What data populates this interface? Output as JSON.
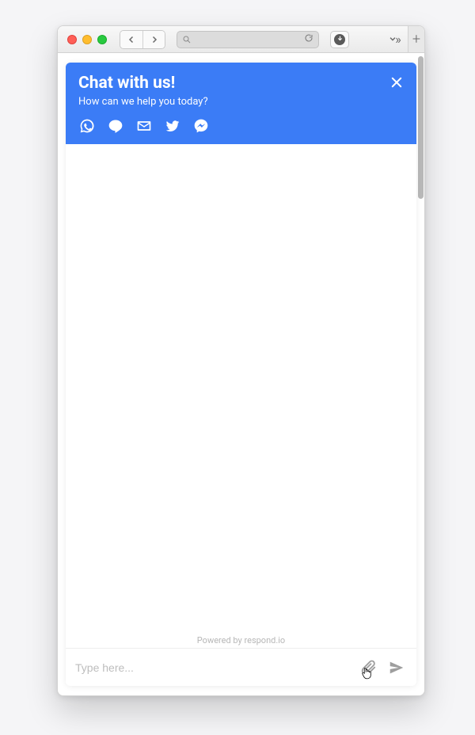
{
  "chat": {
    "title": "Chat with us!",
    "subtitle": "How can we help you today?",
    "powered_by": "Powered by respond.io",
    "input_placeholder": "Type here...",
    "channels": [
      "whatsapp",
      "line",
      "email",
      "twitter",
      "messenger"
    ]
  }
}
